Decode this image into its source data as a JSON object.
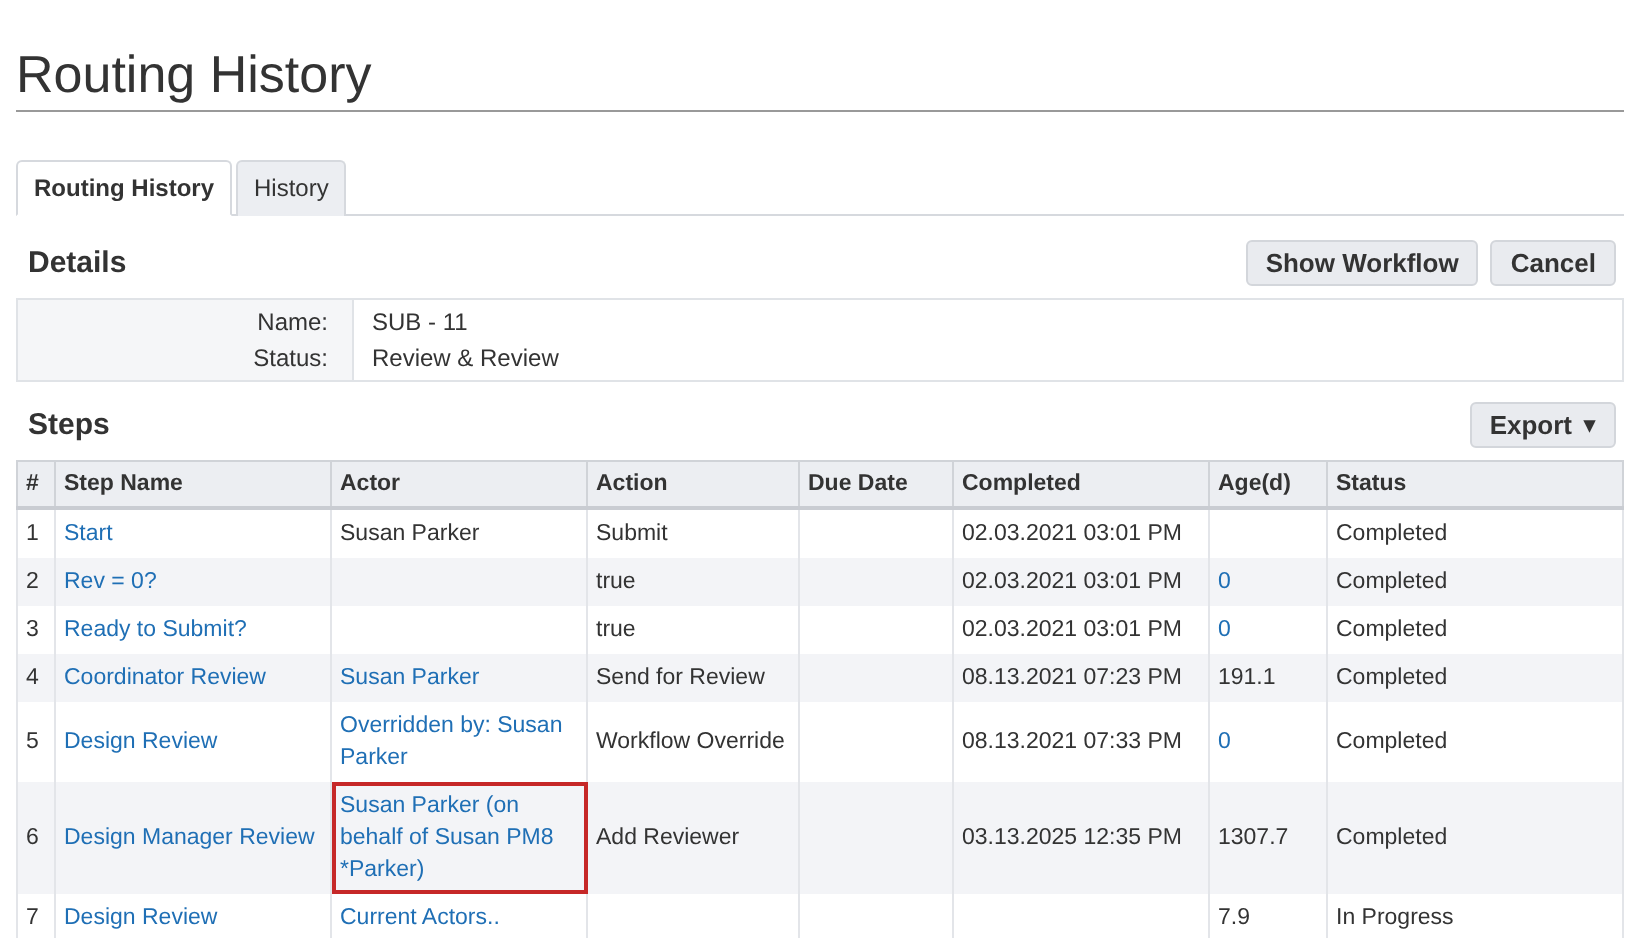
{
  "page_title": "Routing History",
  "tabs": [
    {
      "label": "Routing History",
      "selected": true
    },
    {
      "label": "History",
      "selected": false
    }
  ],
  "details": {
    "heading": "Details",
    "buttons": [
      "Show Workflow",
      "Cancel"
    ],
    "fields": [
      {
        "label": "Name:",
        "value": "SUB - 11"
      },
      {
        "label": "Status:",
        "value": "Review & Review"
      }
    ]
  },
  "steps": {
    "heading": "Steps",
    "export_button": "Export",
    "caret": "▾",
    "columns": [
      "#",
      "Step Name",
      "Actor",
      "Action",
      "Due Date",
      "Completed",
      "Age(d)",
      "Status"
    ],
    "rows": [
      {
        "actor_highlighted": false,
        "cells": [
          {
            "text": "1",
            "kind": "text"
          },
          {
            "text": "Start",
            "kind": "link"
          },
          {
            "text": "Susan Parker",
            "kind": "text"
          },
          {
            "text": "Submit",
            "kind": "text"
          },
          null,
          {
            "text": "02.03.2021 03:01 PM",
            "kind": "text"
          },
          null,
          {
            "text": "Completed",
            "kind": "text"
          }
        ]
      },
      {
        "actor_highlighted": false,
        "cells": [
          {
            "text": "2",
            "kind": "text"
          },
          {
            "text": "Rev = 0?",
            "kind": "link"
          },
          null,
          {
            "text": "true",
            "kind": "text"
          },
          null,
          {
            "text": "02.03.2021 03:01 PM",
            "kind": "text"
          },
          {
            "text": "0",
            "kind": "link"
          },
          {
            "text": "Completed",
            "kind": "text"
          }
        ]
      },
      {
        "actor_highlighted": false,
        "cells": [
          {
            "text": "3",
            "kind": "text"
          },
          {
            "text": "Ready to Submit?",
            "kind": "link"
          },
          null,
          {
            "text": "true",
            "kind": "text"
          },
          null,
          {
            "text": "02.03.2021 03:01 PM",
            "kind": "text"
          },
          {
            "text": "0",
            "kind": "link"
          },
          {
            "text": "Completed",
            "kind": "text"
          }
        ]
      },
      {
        "actor_highlighted": false,
        "cells": [
          {
            "text": "4",
            "kind": "text"
          },
          {
            "text": "Coordinator Review",
            "kind": "link"
          },
          {
            "text": "Susan Parker",
            "kind": "link"
          },
          {
            "text": "Send for Review",
            "kind": "text"
          },
          null,
          {
            "text": "08.13.2021 07:23 PM",
            "kind": "text"
          },
          {
            "text": "191.1",
            "kind": "text"
          },
          {
            "text": "Completed",
            "kind": "text"
          }
        ]
      },
      {
        "actor_highlighted": false,
        "cells": [
          {
            "text": "5",
            "kind": "text"
          },
          {
            "text": "Design Review",
            "kind": "link"
          },
          {
            "text": "Overridden by: Susan Parker",
            "kind": "link"
          },
          {
            "text": "Workflow Override",
            "kind": "text"
          },
          null,
          {
            "text": "08.13.2021 07:33 PM",
            "kind": "text"
          },
          {
            "text": "0",
            "kind": "link"
          },
          {
            "text": "Completed",
            "kind": "text"
          }
        ]
      },
      {
        "actor_highlighted": true,
        "cells": [
          {
            "text": "6",
            "kind": "text"
          },
          {
            "text": "Design Manager Review",
            "kind": "link"
          },
          {
            "text": "Susan Parker (on behalf of Susan PM8 *Parker)",
            "kind": "link"
          },
          {
            "text": "Add Reviewer",
            "kind": "text"
          },
          null,
          {
            "text": "03.13.2025 12:35 PM",
            "kind": "text"
          },
          {
            "text": "1307.7",
            "kind": "text"
          },
          {
            "text": "Completed",
            "kind": "text"
          }
        ]
      },
      {
        "actor_highlighted": false,
        "cells": [
          {
            "text": "7",
            "kind": "text"
          },
          {
            "text": "Design Review",
            "kind": "link"
          },
          {
            "text": "Current Actors..",
            "kind": "link"
          },
          null,
          null,
          null,
          {
            "text": "7.9",
            "kind": "text"
          },
          {
            "text": "In Progress",
            "kind": "text"
          }
        ]
      }
    ]
  }
}
